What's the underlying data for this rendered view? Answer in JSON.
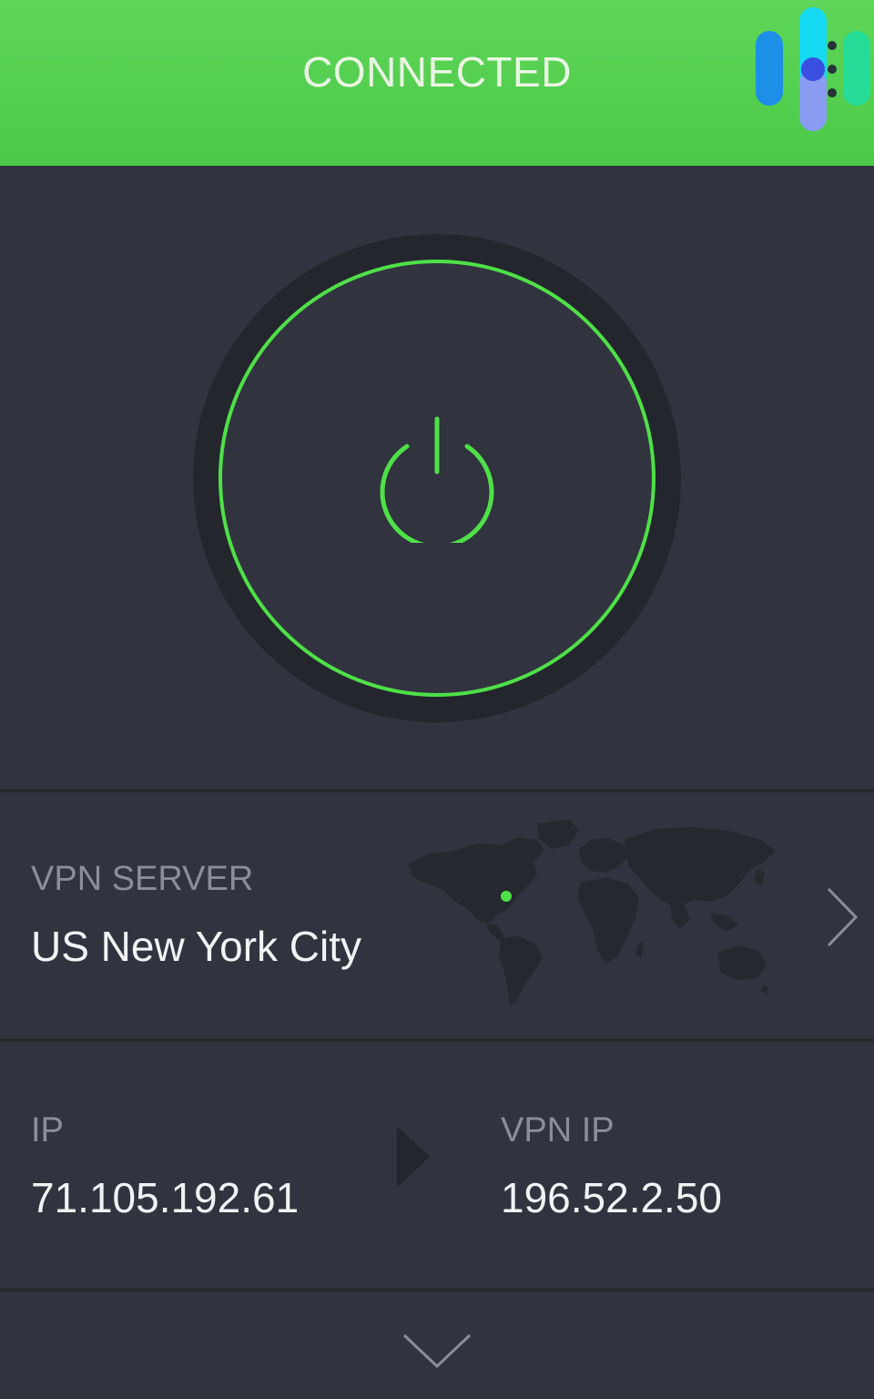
{
  "header": {
    "status": "CONNECTED",
    "logo_icon": "bars-logo-icon"
  },
  "power": {
    "icon": "power-icon",
    "accent_color": "#4fe048"
  },
  "server": {
    "label": "VPN SERVER",
    "value": "US New York City",
    "map_icon": "world-map-icon",
    "chevron_icon": "chevron-right-icon"
  },
  "ip": {
    "label": "IP",
    "value": "71.105.192.61"
  },
  "vpn_ip": {
    "label": "VPN IP",
    "value": "196.52.2.50"
  },
  "footer": {
    "expand_icon": "chevron-down-icon"
  },
  "colors": {
    "header": "#55cf50",
    "background": "#31333f",
    "accent": "#4fe048"
  }
}
